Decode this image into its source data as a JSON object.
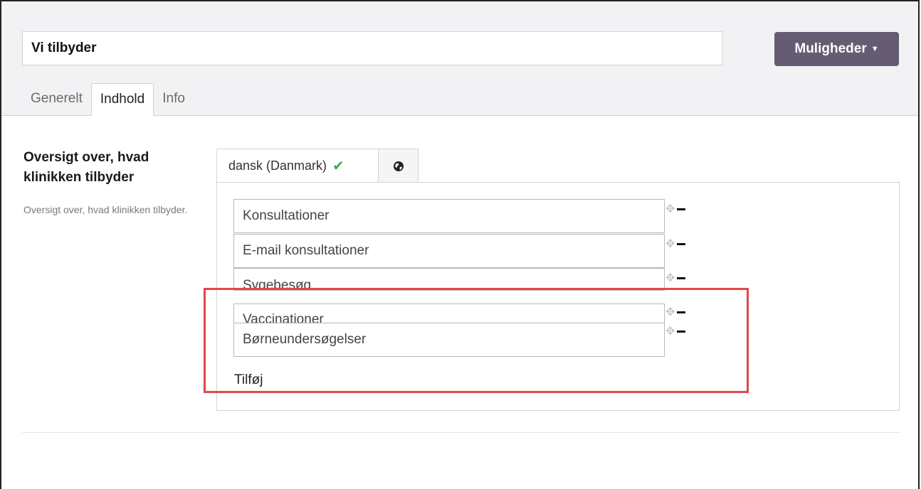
{
  "header": {
    "title_value": "Vi tilbyder",
    "options_label": "Muligheder",
    "tabs": [
      {
        "label": "Generelt"
      },
      {
        "label": "Indhold"
      },
      {
        "label": "Info"
      }
    ]
  },
  "field": {
    "title": "Oversigt over, hvad klinikken tilbyder",
    "description": "Oversigt over, hvad klinikken tilbyder."
  },
  "language_tabs": {
    "active_label": "dansk (Danmark)",
    "check_icon": "✔",
    "globe_icon": "globe-icon"
  },
  "items": [
    {
      "label": "Konsultationer"
    },
    {
      "label": "E-mail konsultationer"
    },
    {
      "label": "Sygebesøg"
    },
    {
      "label": "Vaccinationer"
    },
    {
      "label": "Børneundersøgelser"
    }
  ],
  "add_label": "Tilføj",
  "colors": {
    "accent_button": "#655b72",
    "highlight": "#e04848",
    "check": "#3fae49"
  }
}
